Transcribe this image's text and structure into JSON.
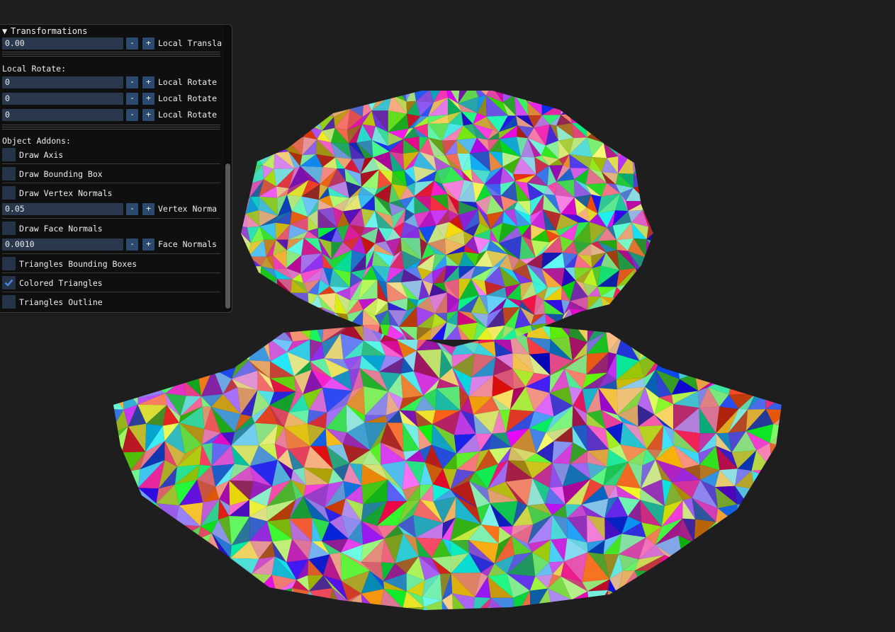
{
  "panel": {
    "header": "Transformations",
    "translate_value": "0.00",
    "translate_label": "Local Transla",
    "rotate_title": "Local Rotate:",
    "rotate_rows": [
      {
        "value": "0",
        "label": "Local Rotate"
      },
      {
        "value": "0",
        "label": "Local Rotate"
      },
      {
        "value": "0",
        "label": "Local Rotate"
      }
    ],
    "addons_title": "Object Addons:",
    "draw_axis": "Draw Axis",
    "draw_bbox": "Draw Bounding Box",
    "draw_vn": "Draw Vertex Normals",
    "vn_value": "0.05",
    "vn_label": "Vertex Norma",
    "draw_fn": "Draw Face Normals",
    "fn_value": "0.0010",
    "fn_label": "Face Normals",
    "tri_bbox": "Triangles Bounding Boxes",
    "colored": "Colored Triangles",
    "outline": "Triangles Outline",
    "minus": "-",
    "plus": "+",
    "checkbox_states": {
      "draw_axis": false,
      "draw_bbox": false,
      "draw_vn": false,
      "draw_fn": false,
      "tri_bbox": false,
      "colored": true,
      "outline": false
    }
  },
  "colors": {
    "background": "#1e1e1e",
    "panel": "#0f0f0f",
    "field": "#29384d",
    "button": "#2c4a6f",
    "check": "#4d8fe6"
  }
}
